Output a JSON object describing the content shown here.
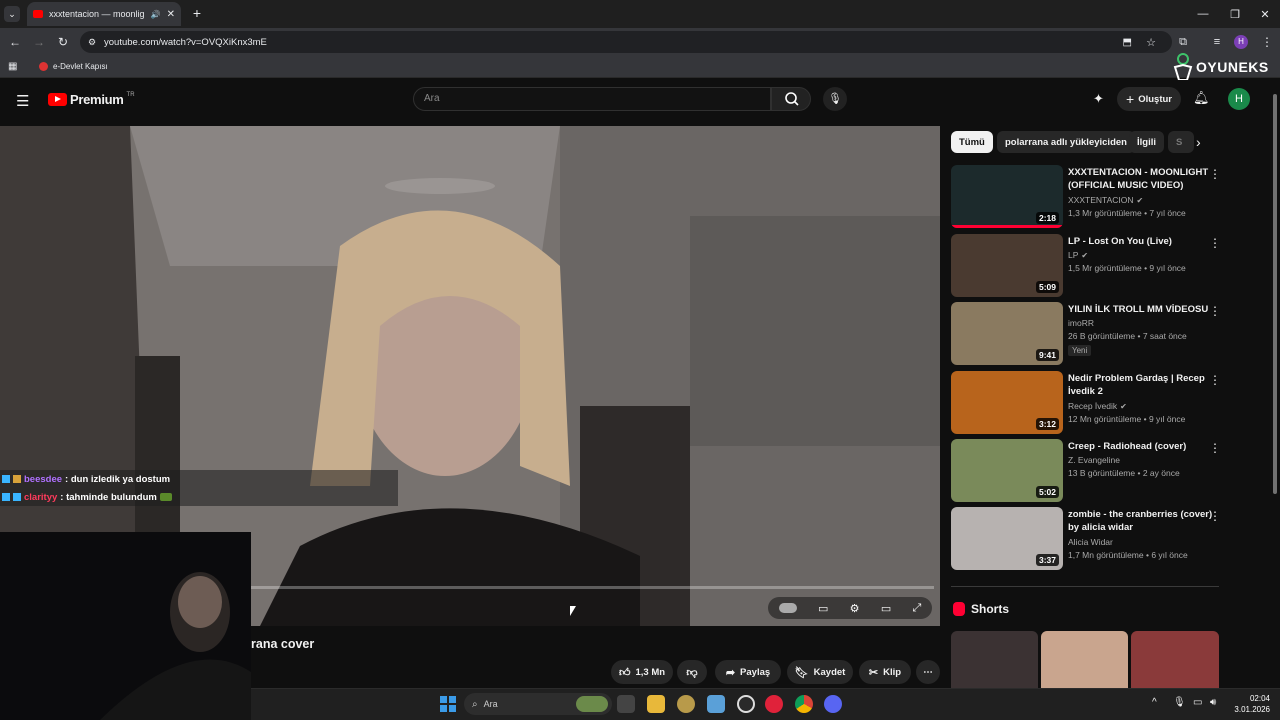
{
  "browser": {
    "tab_title": "xxxtentacion — moonlight",
    "url": "youtube.com/watch?v=OVQXiKnx3mE",
    "bookmark": "e-Devlet Kapısı"
  },
  "overlay": {
    "brand": "OYUNEKS",
    "chat": [
      {
        "user": "beesdee",
        "user_color": "#b071ff",
        "message": ": dun izledik ya dostum"
      },
      {
        "user": "clarityy",
        "user_color": "#ff3b5c",
        "message": ": tahminde bulundum"
      }
    ]
  },
  "youtube": {
    "logo_text": "Premium",
    "region": "TR",
    "search_placeholder": "Ara",
    "create_label": "Oluştur",
    "avatar_letter": "H",
    "video_title_partial": "rana cover",
    "actions": {
      "like": "1,3 Mn",
      "share": "Paylaş",
      "save": "Kaydet",
      "clip": "Klip"
    },
    "chips": [
      "Tümü",
      "polarrana adlı yükleyiciden",
      "İlgili",
      "S"
    ],
    "recommendations": [
      {
        "title": "XXXTENTACION - MOONLIGHT (OFFICIAL MUSIC VIDEO)",
        "channel": "XXXTENTACION",
        "verified": true,
        "views": "1,3 Mr görüntüleme",
        "age": "7 yıl önce",
        "duration": "2:18",
        "music": true,
        "thumb_color": "#1c2a2c",
        "progress": 1
      },
      {
        "title": "LP - Lost On You (Live)",
        "channel": "LP",
        "verified": true,
        "views": "1,5 Mr görüntüleme",
        "age": "9 yıl önce",
        "duration": "5:09",
        "music": true,
        "thumb_color": "#4a3a30"
      },
      {
        "title": "YILIN İLK TROLL MM VİDEOSU",
        "channel": "imoRR",
        "verified": false,
        "views": "26 B görüntüleme",
        "age": "7 saat önce",
        "duration": "9:41",
        "music": false,
        "badge": "Yeni",
        "thumb_color": "#8a7a60"
      },
      {
        "title": "Nedir Problem Gardaş | Recep İvedik 2",
        "channel": "Recep İvedik",
        "verified": true,
        "views": "12 Mn görüntüleme",
        "age": "9 yıl önce",
        "duration": "3:12",
        "music": false,
        "thumb_color": "#b8641c"
      },
      {
        "title": "Creep - Radiohead (cover)",
        "channel": "Z. Evangeline",
        "verified": false,
        "views": "13 B görüntüleme",
        "age": "2 ay önce",
        "duration": "5:02",
        "music": true,
        "thumb_color": "#7a8a5a"
      },
      {
        "title": "zombie - the cranberries (cover) by alicia widar",
        "channel": "Alicia Widar",
        "verified": false,
        "views": "1,7 Mn görüntüleme",
        "age": "6 yıl önce",
        "duration": "3:37",
        "music": true,
        "thumb_color": "#b7b2b0"
      }
    ],
    "shorts_label": "Shorts"
  },
  "taskbar": {
    "search_placeholder": "Ara",
    "time": "02:04",
    "date": "3.01.2026"
  }
}
